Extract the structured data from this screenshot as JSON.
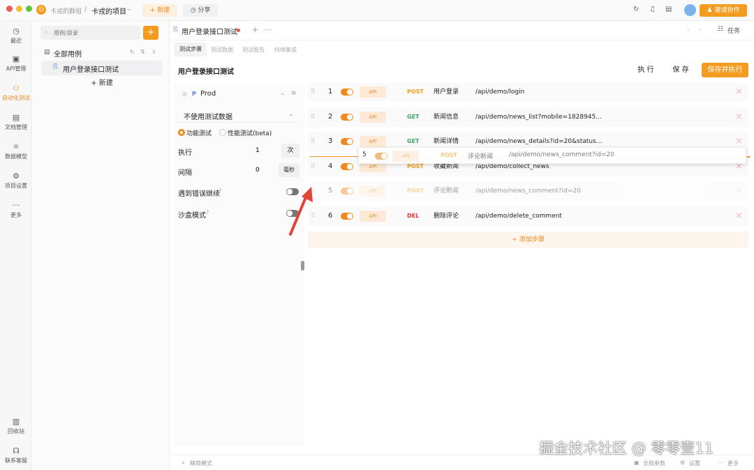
{
  "titlebar": {
    "team": "卡戎的群组",
    "separator": "/",
    "project": "卡戎的项目",
    "new_label": "新建",
    "share_label": "分享",
    "invite_label": "邀请协作"
  },
  "sidebar": {
    "items": [
      {
        "label": "最近",
        "icon": "clock-icon"
      },
      {
        "label": "API管理",
        "icon": "api-icon"
      },
      {
        "label": "自动化测试",
        "icon": "automation-icon"
      },
      {
        "label": "文档管理",
        "icon": "document-icon"
      },
      {
        "label": "数据模型",
        "icon": "model-icon"
      },
      {
        "label": "项目设置",
        "icon": "settings-icon"
      },
      {
        "label": "更多",
        "icon": "more-icon"
      }
    ],
    "bottom": [
      {
        "label": "回收站",
        "icon": "trash-icon"
      },
      {
        "label": "联系客服",
        "icon": "headset-icon"
      }
    ]
  },
  "tree": {
    "search_placeholder": "用例/目录",
    "root_label": "全部用例",
    "case_label": "用户登录接口测试",
    "new_label": "新建"
  },
  "tab": {
    "title": "用户登录接口测试",
    "tasks_label": "任务"
  },
  "subtabs": [
    "测试步骤",
    "测试数据",
    "测试报告",
    "持续集成"
  ],
  "page": {
    "title": "用户登录接口测试",
    "run_label": "执 行",
    "save_label": "保 存",
    "save_run_label": "保存并执行"
  },
  "config": {
    "env_label": "Prod",
    "env_badge": "P",
    "data_select": "不使用测试数据",
    "mode_functional": "功能测试",
    "mode_performance": "性能测试(beta)",
    "exec_label": "执行",
    "exec_value": "1",
    "exec_unit": "次",
    "interval_label": "间隔",
    "interval_value": "0",
    "interval_unit": "毫秒",
    "continue_on_error": "遇到错误继续",
    "sandbox_mode": "沙盒模式"
  },
  "steps": [
    {
      "num": "1",
      "tag": "API",
      "method": "POST",
      "name": "用户登录",
      "path": "/api/demo/login"
    },
    {
      "num": "2",
      "tag": "API",
      "method": "GET",
      "name": "新闻信息",
      "path": "/api/demo/news_list?mobile=1828945..."
    },
    {
      "num": "3",
      "tag": "API",
      "method": "GET",
      "name": "新闻详情",
      "path": "/api/demo/news_details?id=20&status..."
    },
    {
      "num": "4",
      "tag": "API",
      "method": "POST",
      "name": "收藏新闻",
      "path": "/api/demo/collect_news"
    },
    {
      "num": "5",
      "tag": "API",
      "method": "POST",
      "name": "评论新闻",
      "path": "/api/demo/news_comment?id=20"
    },
    {
      "num": "6",
      "tag": "API",
      "method": "DEL",
      "name": "删除评论",
      "path": "/api/demo/delete_comment"
    }
  ],
  "drag_ghost": {
    "num": "5",
    "tag": "API",
    "method": "POST",
    "name": "评论新闻",
    "path": "/api/demo/news_comment?id=20"
  },
  "add_step_label": "添加步骤",
  "footer": {
    "left": "精简模式",
    "global_params": "全局参数",
    "settings": "设置",
    "more": "更多"
  },
  "watermark": "掘金技术社区 @ 零零壹11",
  "colors": {
    "accent": "#f08a1c",
    "post": "#f0a020",
    "get": "#3aa56b",
    "del": "#e0343a"
  }
}
